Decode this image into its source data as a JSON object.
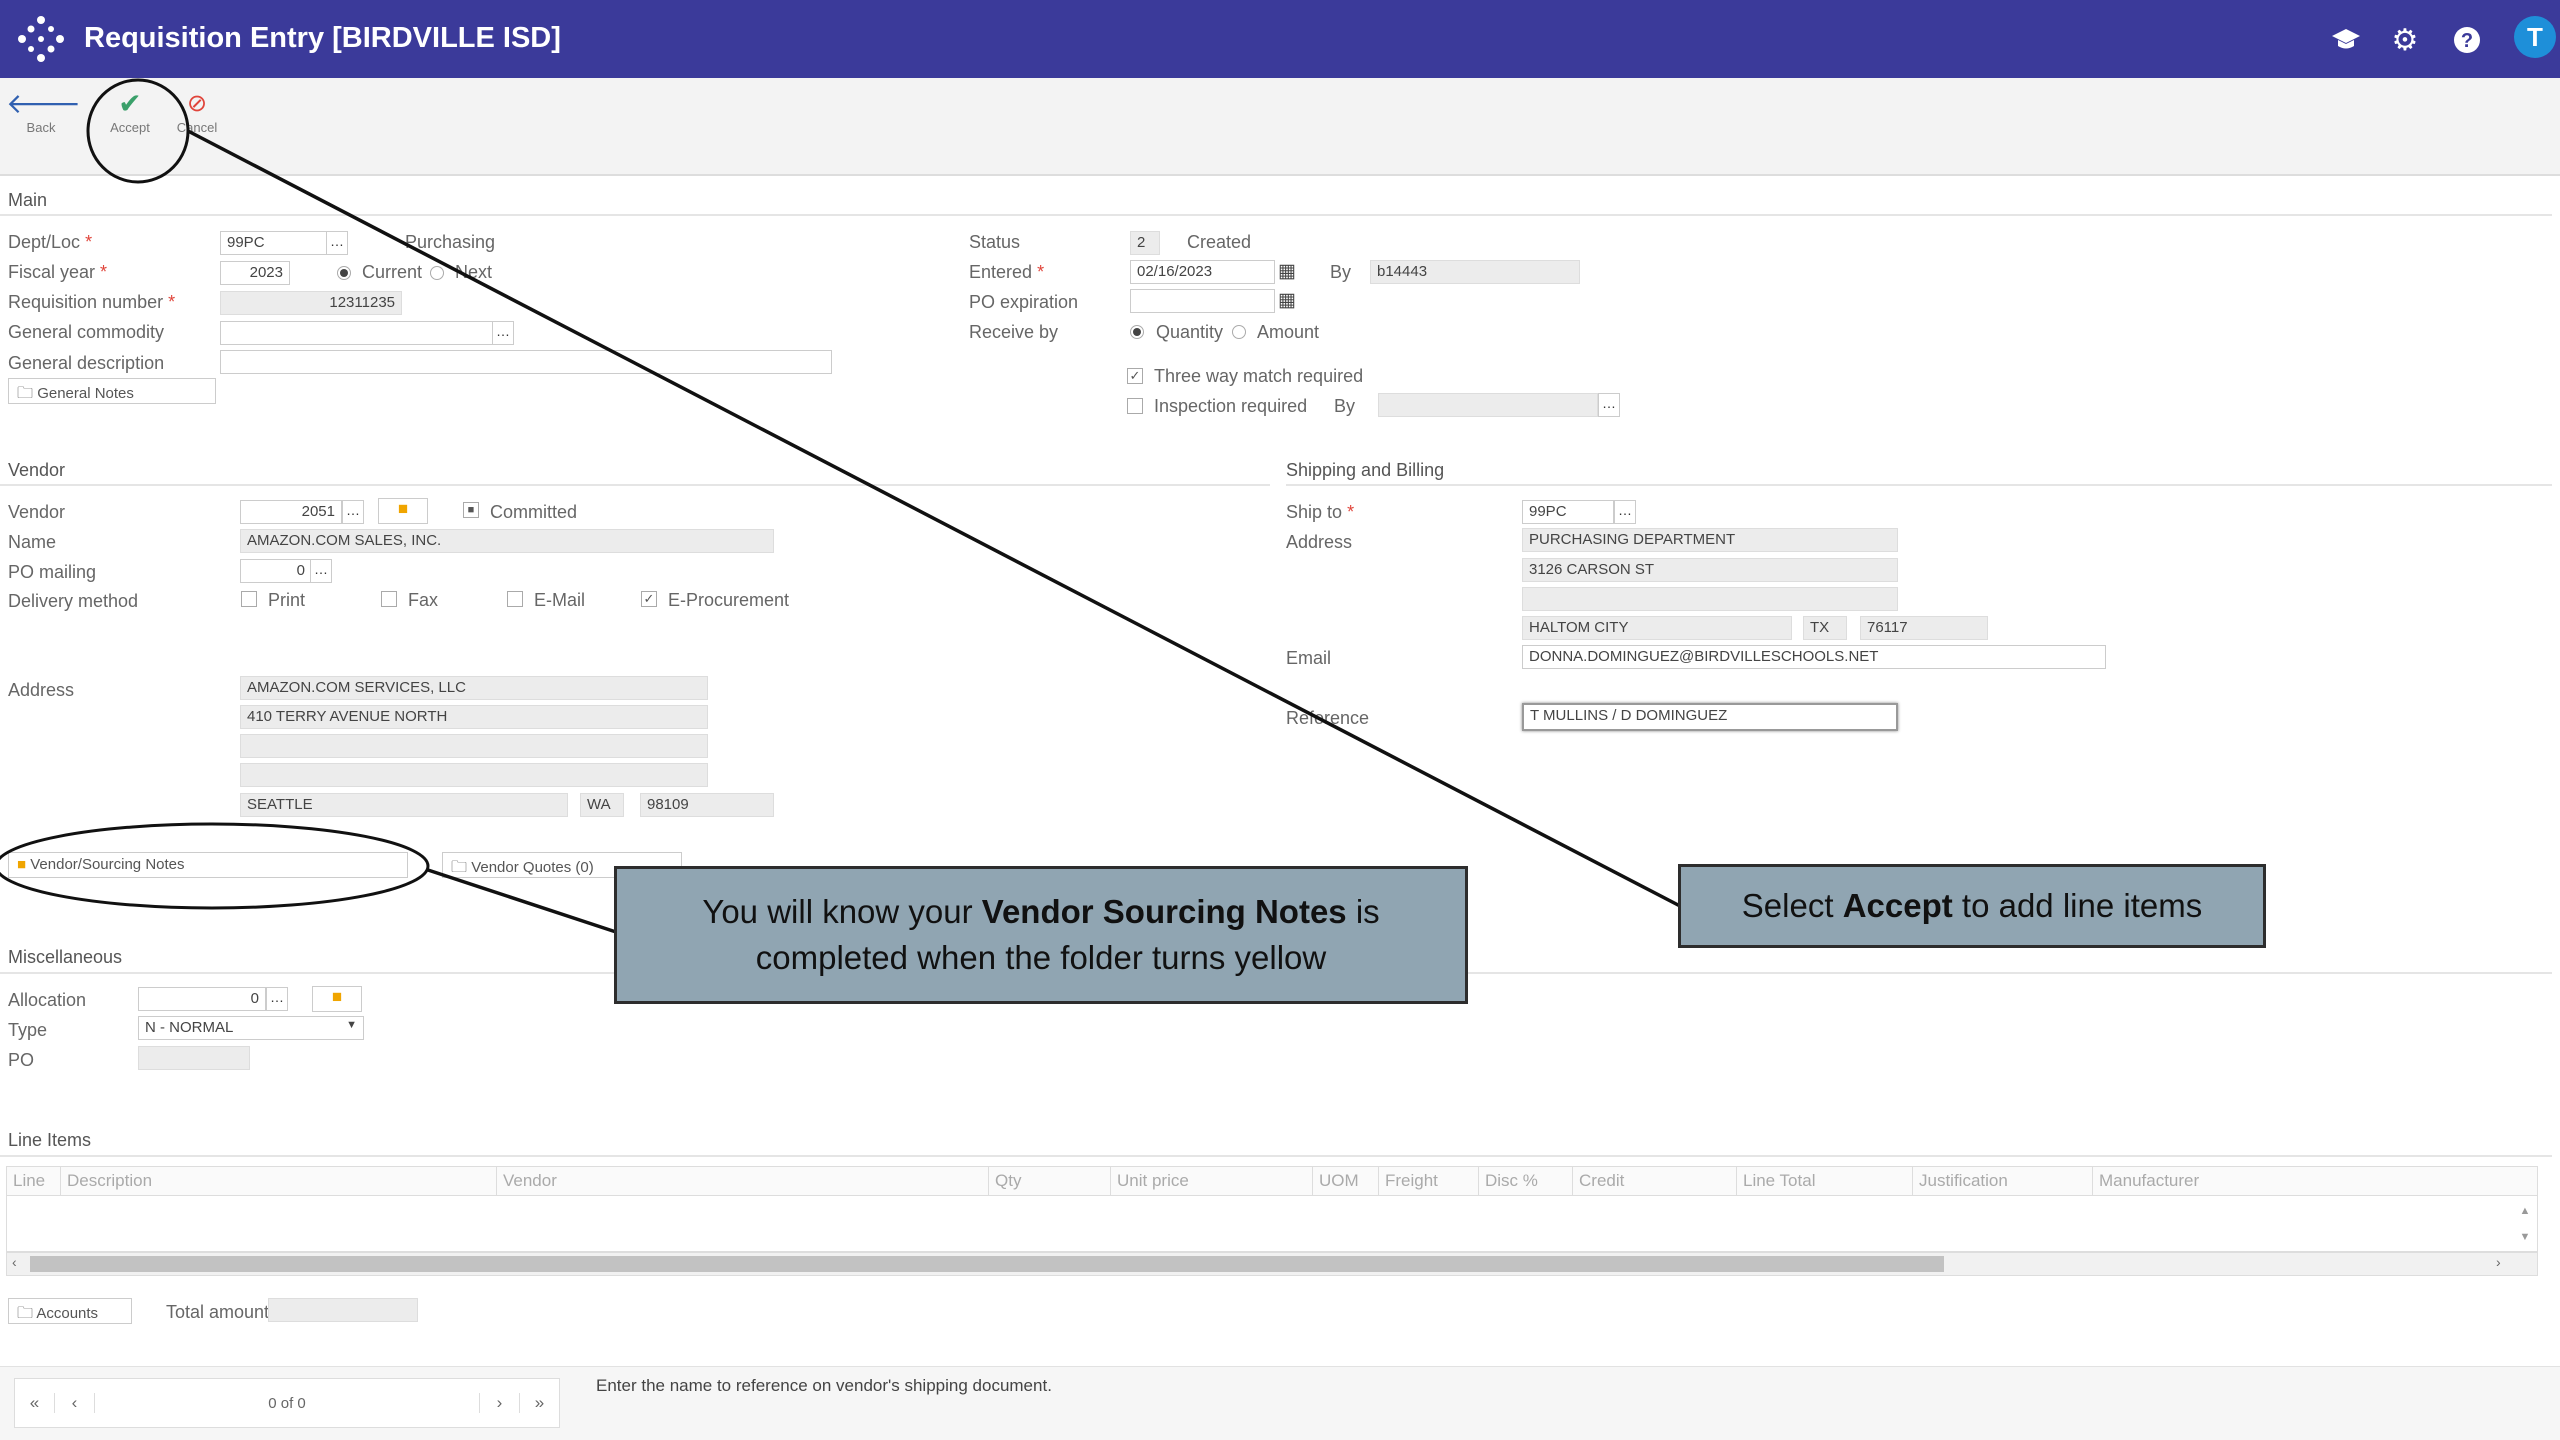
{
  "app": {
    "title": "Requisition Entry [BIRDVILLE ISD]",
    "avatar_letter": "T"
  },
  "toolbar": {
    "back": "Back",
    "accept": "Accept",
    "cancel": "Cancel"
  },
  "main": {
    "section": "Main",
    "dept_loc_label": "Dept/Loc",
    "dept_loc": "99PC",
    "dept_loc_desc": "Purchasing",
    "fiscal_year_label": "Fiscal year",
    "fiscal_year": "2023",
    "fy_current": "Current",
    "fy_next": "Next",
    "req_number_label": "Requisition number",
    "req_number": "12311235",
    "gen_commodity_label": "General commodity",
    "gen_desc_label": "General description",
    "general_notes": "General Notes",
    "status_label": "Status",
    "status_code": "2",
    "status_text": "Created",
    "entered_label": "Entered",
    "entered": "02/16/2023",
    "by_label": "By",
    "by": "b14443",
    "po_expiration_label": "PO expiration",
    "receive_by_label": "Receive by",
    "receive_quantity": "Quantity",
    "receive_amount": "Amount",
    "three_way": "Three way match required",
    "inspection": "Inspection required",
    "inspection_by": "By"
  },
  "vendor": {
    "section": "Vendor",
    "vendor_label": "Vendor",
    "vendor": "2051",
    "committed": "Committed",
    "name_label": "Name",
    "name": "AMAZON.COM SALES, INC.",
    "po_mailing_label": "PO mailing",
    "po_mailing": "0",
    "delivery_label": "Delivery method",
    "print": "Print",
    "fax": "Fax",
    "email": "E-Mail",
    "eproc": "E-Procurement",
    "address_label": "Address",
    "addr1": "AMAZON.COM SERVICES, LLC",
    "addr2": "410 TERRY AVENUE NORTH",
    "city": "SEATTLE",
    "state": "WA",
    "zip": "98109",
    "sourcing_notes": "Vendor/Sourcing Notes",
    "quotes": "Vendor Quotes (0)"
  },
  "shipping": {
    "section": "Shipping and Billing",
    "ship_to_label": "Ship to",
    "ship_to": "99PC",
    "address_label": "Address",
    "addr1": "PURCHASING DEPARTMENT",
    "addr2": "3126 CARSON ST",
    "city": "HALTOM CITY",
    "state": "TX",
    "zip": "76117",
    "email_label": "Email",
    "email": "DONNA.DOMINGUEZ@BIRDVILLESCHOOLS.NET",
    "reference_label": "Reference",
    "reference": "T MULLINS / D DOMINGUEZ"
  },
  "misc": {
    "section": "Miscellaneous",
    "allocation_label": "Allocation",
    "allocation": "0",
    "type_label": "Type",
    "type": "N - NORMAL",
    "po_label": "PO"
  },
  "line_items": {
    "section": "Line Items",
    "columns": [
      "Line",
      "Description",
      "Vendor",
      "Qty",
      "Unit price",
      "UOM",
      "Freight",
      "Disc %",
      "Credit",
      "Line Total",
      "Justification",
      "Manufacturer"
    ]
  },
  "footer": {
    "accounts": "Accounts",
    "total_amount": "Total amount",
    "pager": "0 of 0",
    "hint": "Enter the name to reference on vendor's shipping document."
  },
  "callouts": {
    "vendor_pre": "You will know your ",
    "vendor_bold": "Vendor Sourcing Notes",
    "vendor_post": " is",
    "vendor_line2": "completed when the folder turns yellow",
    "accept_pre": "Select ",
    "accept_bold": "Accept",
    "accept_post": " to add line items"
  },
  "colors": {
    "header": "#3b3a9a",
    "folder_yellow": "#f0a500",
    "callout": "#90a5b2"
  }
}
